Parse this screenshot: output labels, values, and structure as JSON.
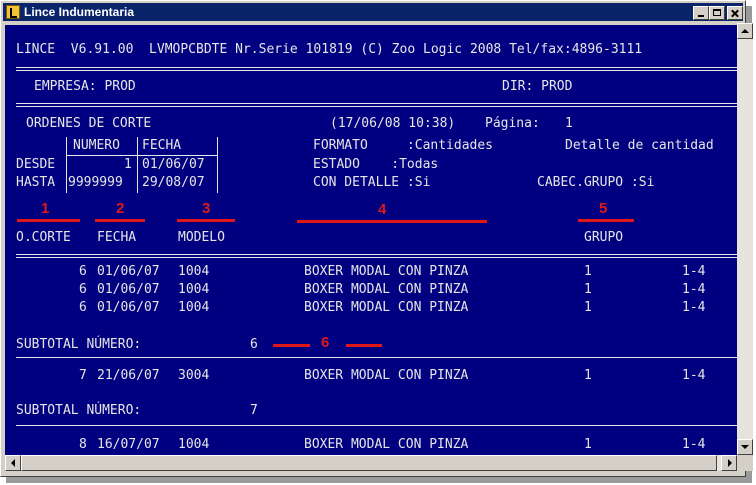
{
  "window": {
    "title": "Lince Indumentaria",
    "console_bg": "#000080",
    "text_color": "#e6e6e6",
    "annotation_color": "#e01818"
  },
  "console": {
    "header_line": "LINCE  V6.91.00  LVMOPCBDTE Nr.Serie 101819 (C) Zoo Logic 2008 Tel/fax:4896-3111",
    "empresa": "EMPRESA: PROD",
    "dir": "DIR: PROD",
    "report_title": "ORDENES DE CORTE",
    "timestamp": "(17/06/08 10:38)",
    "page_label": "Página:",
    "page_number": "1",
    "filter": {
      "numero_header": "NUMERO",
      "fecha_header": "FECHA",
      "desde_label": "DESDE",
      "hasta_label": "HASTA",
      "desde_numero": "1",
      "desde_fecha": "01/06/07",
      "hasta_numero": "9999999",
      "hasta_fecha": "29/08/07"
    },
    "options": {
      "formato": "FORMATO     :Cantidades",
      "detalle": "Detalle de cantidad",
      "estado": "ESTADO    :Todas",
      "con_detalle": "CON DETALLE :Si",
      "cabec_grupo": "CABEC.GRUPO :Si"
    },
    "annotations": [
      "1",
      "2",
      "3",
      "4",
      "5",
      "6"
    ],
    "columns": {
      "corte": "O.CORTE",
      "fecha": "FECHA",
      "modelo": "MODELO",
      "grupo": "GRUPO"
    },
    "group1": {
      "rows": [
        {
          "corte": "6",
          "fecha": "01/06/07",
          "modelo": "1004",
          "desc": "BOXER MODAL CON PINZA",
          "grupo": "1",
          "talle": "1-4"
        },
        {
          "corte": "6",
          "fecha": "01/06/07",
          "modelo": "1004",
          "desc": "BOXER MODAL CON PINZA",
          "grupo": "1",
          "talle": "1-4"
        },
        {
          "corte": "6",
          "fecha": "01/06/07",
          "modelo": "1004",
          "desc": "BOXER MODAL CON PINZA",
          "grupo": "1",
          "talle": "1-4"
        }
      ],
      "subtotal_label": "SUBTOTAL NÚMERO:",
      "subtotal_value": "6"
    },
    "group2": {
      "rows": [
        {
          "corte": "7",
          "fecha": "21/06/07",
          "modelo": "3004",
          "desc": "BOXER MODAL CON PINZA",
          "grupo": "1",
          "talle": "1-4"
        }
      ],
      "subtotal_label": "SUBTOTAL NÚMERO:",
      "subtotal_value": "7"
    },
    "group3": {
      "rows": [
        {
          "corte": "8",
          "fecha": "16/07/07",
          "modelo": "1004",
          "desc": "BOXER MODAL CON PINZA",
          "grupo": "1",
          "talle": "1-4"
        }
      ]
    }
  },
  "icons": [
    "app-icon",
    "minimize-icon",
    "maximize-icon",
    "close-icon",
    "scroll-up-icon",
    "scroll-down-icon",
    "scroll-left-icon",
    "scroll-right-icon"
  ]
}
